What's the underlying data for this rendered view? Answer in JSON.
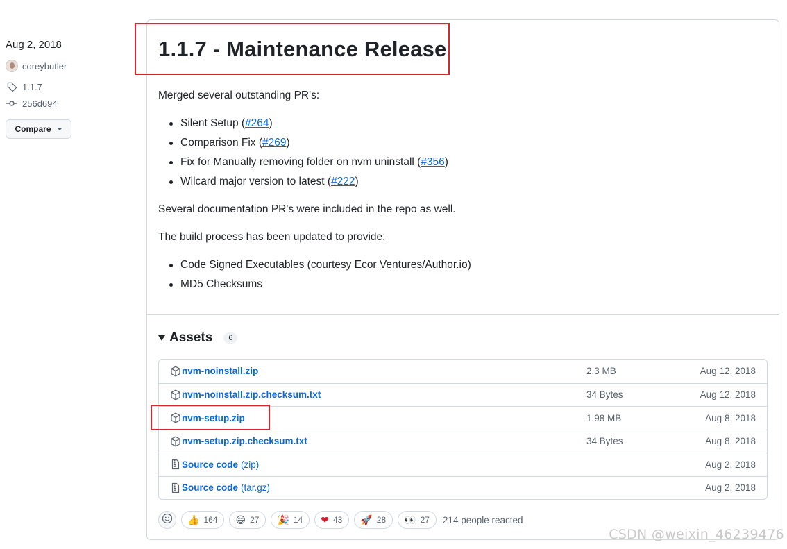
{
  "meta": {
    "date": "Aug 2, 2018",
    "author": "coreybutler",
    "tag": "1.1.7",
    "commit": "256d694",
    "compare_label": "Compare"
  },
  "release": {
    "title": "1.1.7 - Maintenance Release",
    "intro": "Merged several outstanding PR's:",
    "prs": [
      {
        "text": "Silent Setup (",
        "link": "#264",
        "end": ")"
      },
      {
        "text": "Comparison Fix (",
        "link": "#269",
        "end": ")"
      },
      {
        "text": "Fix for Manually removing folder on nvm uninstall (",
        "link": "#356",
        "end": ")"
      },
      {
        "text": "Wilcard major version to latest (",
        "link": "#222",
        "end": ")"
      }
    ],
    "docs_note": "Several documentation PR's were included in the repo as well.",
    "build_note": "The build process has been updated to provide:",
    "build_items": [
      "Code Signed Executables (courtesy Ecor Ventures/Author.io)",
      "MD5 Checksums"
    ]
  },
  "assets": {
    "title": "Assets",
    "count": "6",
    "rows": [
      {
        "name": "nvm-noinstall.zip",
        "sub": "",
        "size": "2.3 MB",
        "date": "Aug 12, 2018",
        "icon": "package-icon"
      },
      {
        "name": "nvm-noinstall.zip.checksum.txt",
        "sub": "",
        "size": "34 Bytes",
        "date": "Aug 12, 2018",
        "icon": "package-icon"
      },
      {
        "name": "nvm-setup.zip",
        "sub": "",
        "size": "1.98 MB",
        "date": "Aug 8, 2018",
        "icon": "package-icon"
      },
      {
        "name": "nvm-setup.zip.checksum.txt",
        "sub": "",
        "size": "34 Bytes",
        "date": "Aug 8, 2018",
        "icon": "package-icon"
      },
      {
        "name": "Source code",
        "sub": "(zip)",
        "size": "",
        "date": "Aug 2, 2018",
        "icon": "file-zip-icon"
      },
      {
        "name": "Source code",
        "sub": "(tar.gz)",
        "size": "",
        "date": "Aug 2, 2018",
        "icon": "file-zip-icon"
      }
    ]
  },
  "reactions": {
    "items": [
      {
        "emoji": "👍",
        "count": "164",
        "icon": "thumbs-up-icon"
      },
      {
        "emoji": "😄",
        "count": "27",
        "icon": "laugh-icon"
      },
      {
        "emoji": "🎉",
        "count": "14",
        "icon": "hooray-icon"
      },
      {
        "emoji": "❤",
        "count": "43",
        "icon": "heart-icon"
      },
      {
        "emoji": "🚀",
        "count": "28",
        "icon": "rocket-icon"
      },
      {
        "emoji": "👀",
        "count": "27",
        "icon": "eyes-icon"
      }
    ],
    "summary": "214 people reacted"
  },
  "watermark": "CSDN @weixin_46239476",
  "colors": {
    "link": "#0969da",
    "highlight": "#d9252b",
    "heart": "#cf222e"
  }
}
